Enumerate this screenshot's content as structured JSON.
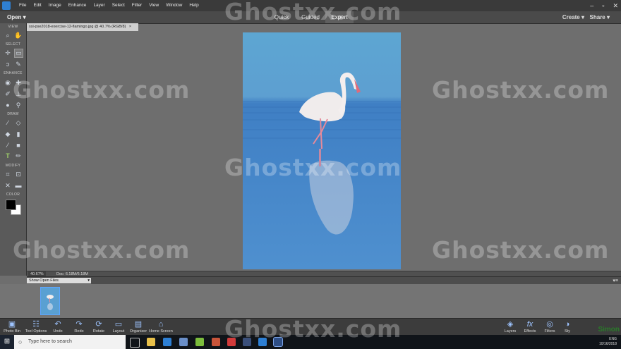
{
  "app": {
    "menu": [
      "File",
      "Edit",
      "Image",
      "Enhance",
      "Layer",
      "Select",
      "Filter",
      "View",
      "Window",
      "Help"
    ],
    "window_controls": [
      "–",
      "▫",
      "✕"
    ]
  },
  "modebar": {
    "open_label": "Open",
    "tabs": [
      "Quick",
      "Guided",
      "Expert"
    ],
    "active_tab": "Expert",
    "create_label": "Create",
    "share_label": "Share"
  },
  "toolbox": {
    "sections": [
      "VIEW",
      "SELECT",
      "ENHANCE",
      "DRAW",
      "MODIFY",
      "COLOR"
    ],
    "foreground_color": "#000000",
    "background_color": "#ffffff"
  },
  "document": {
    "tab_label": "ssi-pse2018-exercise-12-flamingo.jpg @ 40.7% (RGB/8)",
    "tab_close": "×",
    "zoom": "40.67%",
    "doc_size": "Doc: 6.18M/6.18M"
  },
  "photo_bin": {
    "dropdown_value": "Show Open Files"
  },
  "actionbar": {
    "left": [
      "Photo Bin",
      "Tool Options",
      "Undo",
      "Redo",
      "Rotate",
      "Layout",
      "Organizer",
      "Home Screen"
    ],
    "right": [
      "Layers",
      "Effects",
      "Filters",
      "Sty"
    ]
  },
  "taskbar": {
    "search_placeholder": "Type here to search",
    "date": "10/16/2018",
    "tray_label": "ENG"
  },
  "watermark": {
    "text": "Ghostxx.com"
  },
  "logo": {
    "text": "Simon"
  },
  "colors": {
    "accent": "#2f7fd1",
    "sky_water": "#5aa3d4"
  }
}
